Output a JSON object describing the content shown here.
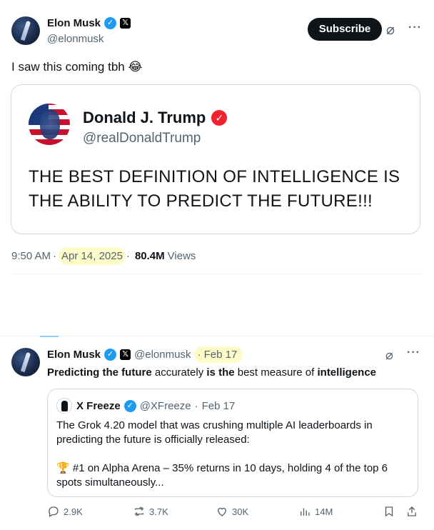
{
  "post1": {
    "author_name": "Elon Musk",
    "author_handle": "@elonmusk",
    "subscribe_label": "Subscribe",
    "text": "I saw this coming tbh",
    "emoji": "😂",
    "quoted": {
      "author_name": "Donald J. Trump",
      "author_handle": "@realDonaldTrump",
      "text": "THE BEST DEFINITION OF INTELLIGENCE IS THE ABILITY TO PREDICT THE FUTURE!!!"
    },
    "time": "9:50 AM",
    "date": "Apr 14, 2025",
    "views_count": "80.4M",
    "views_label": "Views"
  },
  "post2": {
    "author_name": "Elon Musk",
    "author_handle": "@elonmusk",
    "date": "Feb 17",
    "text_parts": {
      "p1": "Predicting the future",
      "p2": " accurately ",
      "p3": "is the",
      "p4": " best measure of ",
      "p5": "intelligence"
    },
    "quoted": {
      "author_name": "X Freeze",
      "author_handle": "@XFreeze",
      "date": "Feb 17",
      "para1": "The Grok 4.20 model that was crushing multiple AI leaderboards in predicting the future is officially released:",
      "para2_icon": "🏆",
      "para2": "#1 on Alpha Arena – 35% returns in 10 days, holding 4 of the top 6 spots simultaneously..."
    },
    "actions": {
      "replies": "2.9K",
      "reposts": "3.7K",
      "likes": "30K",
      "views": "14M"
    }
  },
  "separator": "·",
  "icons": {
    "verified": "verified-check-icon",
    "x_badge": "x-logo-icon",
    "grok": "grok-icon",
    "more": "more-dots-icon",
    "reply": "reply-icon",
    "repost": "repost-icon",
    "like": "heart-icon",
    "views": "views-chart-icon",
    "bookmark": "bookmark-icon",
    "share": "share-icon"
  },
  "colors": {
    "verified_blue": "#1d9bf0",
    "verified_red": "#f4212e",
    "highlight": "#fdfcc8",
    "secondary_text": "#536471"
  }
}
